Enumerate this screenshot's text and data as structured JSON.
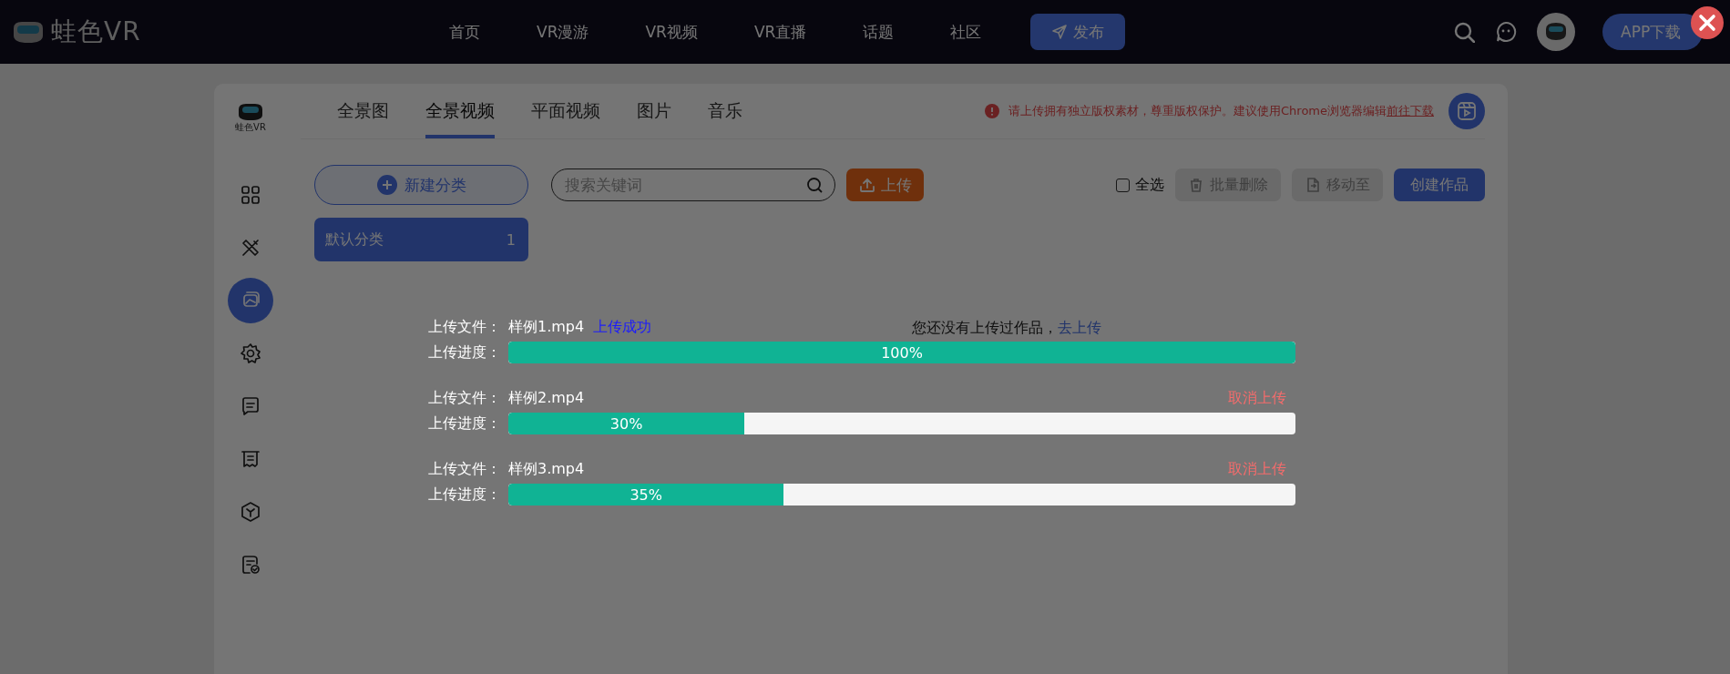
{
  "header": {
    "logo": "蛙色VR",
    "nav": [
      {
        "label": "首页"
      },
      {
        "label": "VR漫游"
      },
      {
        "label": "VR视频"
      },
      {
        "label": "VR直播"
      },
      {
        "label": "话题"
      },
      {
        "label": "社区"
      }
    ],
    "publish": "发布",
    "app_button": "APP下载"
  },
  "card": {
    "logo_caption": "蛙色VR",
    "sidebar": [
      {
        "kind": "grid",
        "selected": false
      },
      {
        "kind": "tools",
        "selected": false
      },
      {
        "kind": "gallery",
        "selected": true
      },
      {
        "kind": "gear",
        "selected": false
      },
      {
        "kind": "message",
        "selected": false
      },
      {
        "kind": "receipt",
        "selected": false
      },
      {
        "kind": "cube",
        "selected": false
      },
      {
        "kind": "checklist",
        "selected": false
      }
    ],
    "tabs": [
      {
        "label": "全景图",
        "selected": false
      },
      {
        "label": "全景视频",
        "selected": true
      },
      {
        "label": "平面视频",
        "selected": false
      },
      {
        "label": "图片",
        "selected": false
      },
      {
        "label": "音乐",
        "selected": false
      }
    ],
    "notice": {
      "text": "请上传拥有独立版权素材，尊重版权保护。建议使用Chrome浏览器编辑",
      "link": "前往下载"
    },
    "new_category": "新建分类",
    "search": {
      "placeholder": "搜索关键词"
    },
    "upload": "上传",
    "select_all": {
      "label": "全选",
      "checked": false
    },
    "buttons": [
      {
        "kind": "delete",
        "label": "批量删除",
        "disabled": true
      },
      {
        "kind": "move",
        "label": "移动至",
        "disabled": true
      },
      {
        "kind": "create",
        "label": "创建作品",
        "disabled": false
      }
    ],
    "categories": [
      {
        "name": "默认分类",
        "count": "1",
        "selected": true
      }
    ],
    "empty": {
      "text": "您还没有上传过作品，",
      "link": "去上传"
    }
  },
  "uploads": [
    {
      "file_label": "上传文件：",
      "file": "样例1.mp4",
      "action": {
        "kind": "success",
        "label": "上传成功"
      },
      "progress_label": "上传进度：",
      "level": 1,
      "reading": "100%"
    },
    {
      "file_label": "上传文件：",
      "file": "样例2.mp4",
      "action": {
        "kind": "cancel",
        "label": "取消上传"
      },
      "progress_label": "上传进度：",
      "level": 0.3,
      "reading": "30%"
    },
    {
      "file_label": "上传文件：",
      "file": "样例3.mp4",
      "action": {
        "kind": "cancel",
        "label": "取消上传"
      },
      "progress_label": "上传进度：",
      "level": 0.35,
      "reading": "35%"
    }
  ]
}
